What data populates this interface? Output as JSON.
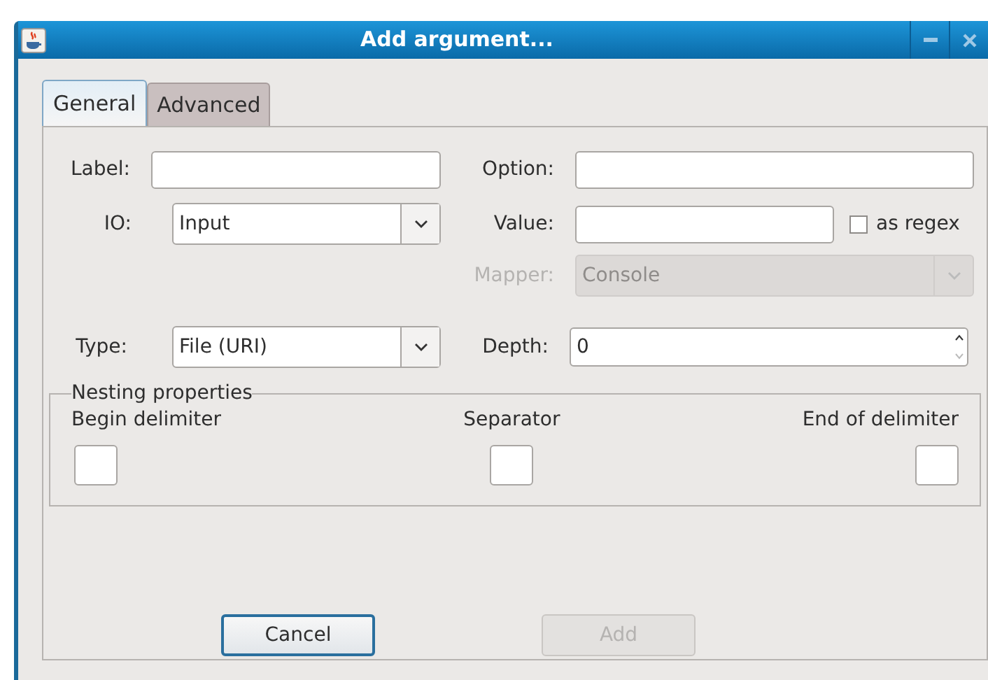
{
  "window": {
    "title": "Add argument..."
  },
  "tabs": [
    {
      "label": "General",
      "selected": true
    },
    {
      "label": "Advanced",
      "selected": false
    }
  ],
  "form": {
    "label_field": {
      "label": "Label:"
    },
    "option_field": {
      "label": "Option:"
    },
    "io": {
      "label": "IO:",
      "value": "Input"
    },
    "value_field": {
      "label": "Value:"
    },
    "as_regex": {
      "label": "as regex",
      "checked": false
    },
    "mapper": {
      "label": "Mapper:",
      "value": "Console",
      "disabled": true
    },
    "type": {
      "label": "Type:",
      "value": "File (URI)"
    },
    "depth": {
      "label": "Depth:",
      "value": "0"
    }
  },
  "nesting": {
    "title": "Nesting properties",
    "fields": [
      {
        "label": "Begin delimiter"
      },
      {
        "label": "Separator"
      },
      {
        "label": "End of delimiter"
      }
    ]
  },
  "buttons": [
    {
      "label": "Cancel",
      "disabled": false,
      "focused": true
    },
    {
      "label": "Add",
      "disabled": true,
      "focused": false
    }
  ]
}
